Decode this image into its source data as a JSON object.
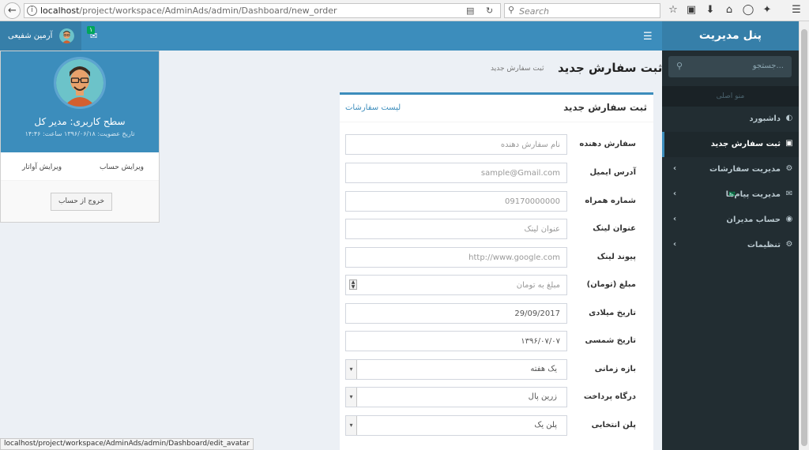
{
  "browser": {
    "url_host": "localhost",
    "url_path": "/project/workspace/AdminAds/admin/Dashboard/new_order",
    "search_placeholder": "Search",
    "status_url": "localhost/project/workspace/AdminAds/admin/Dashboard/edit_avatar"
  },
  "header": {
    "user_name": "آرمین شفیعی",
    "message_count": "۱"
  },
  "sidebar": {
    "brand": "پنل مدیریت",
    "search_placeholder": "جستجو...",
    "section_header": "منو اصلی",
    "items": [
      {
        "label": "داشبورد",
        "icon": "dashboard-icon",
        "active": false
      },
      {
        "label": "ثبت سفارش جدید",
        "icon": "cart-icon",
        "active": true
      },
      {
        "label": "مدیریت سفارشات",
        "icon": "cogs-icon",
        "active": false
      },
      {
        "label": "مدیریت پیام‌ها",
        "icon": "envelope-icon",
        "active": false
      },
      {
        "label": "حساب مدیران",
        "icon": "user-circle-icon",
        "active": false
      },
      {
        "label": "تنظیمات",
        "icon": "gear-icon",
        "active": false
      }
    ]
  },
  "content": {
    "title": "ثبت سفارش جدید",
    "subtitle": "ثبت سفارش جدید"
  },
  "form": {
    "title": "ثبت سفارش جدید",
    "list_link": "لیست سفارشات",
    "fields": [
      {
        "label": "سفارش دهنده",
        "value": "",
        "placeholder": "نام سفارش دهنده"
      },
      {
        "label": "آدرس ایمیل",
        "value": "",
        "placeholder": "sample@Gmail.com"
      },
      {
        "label": "شماره همراه",
        "value": "",
        "placeholder": "09170000000"
      },
      {
        "label": "عنوان لینک",
        "value": "",
        "placeholder": "عنوان لینک"
      },
      {
        "label": "پیوند لینک",
        "value": "",
        "placeholder": "http://www.google.com"
      },
      {
        "label": "مبلغ (تومان)",
        "value": "",
        "placeholder": "مبلغ به تومان"
      },
      {
        "label": "تاریخ میلادی",
        "value": "29/09/2017",
        "placeholder": ""
      },
      {
        "label": "تاریخ شمسی",
        "value": "۱۳۹۶/۰۷/۰۷",
        "placeholder": ""
      },
      {
        "label": "بازه زمانی",
        "value": "یک هفته"
      },
      {
        "label": "درگاه پرداخت",
        "value": "زرین پال"
      },
      {
        "label": "پلن انتخابی",
        "value": "پلن یک"
      }
    ]
  },
  "user_panel": {
    "role": "سطح کاربری: مدیر کل",
    "member_since": "تاریخ عضویت: ۱۳۹۶/۰۶/۱۸ ساعت: ۱۴:۴۶",
    "edit_account": "ویرایش حساب",
    "edit_avatar": "ویرایش آواتار",
    "logout": "خروج از حساب"
  },
  "colors": {
    "primary": "#3c8dbc",
    "primary_dark": "#367fa9",
    "sidebar_bg": "#222d32",
    "success": "#00a65a"
  }
}
